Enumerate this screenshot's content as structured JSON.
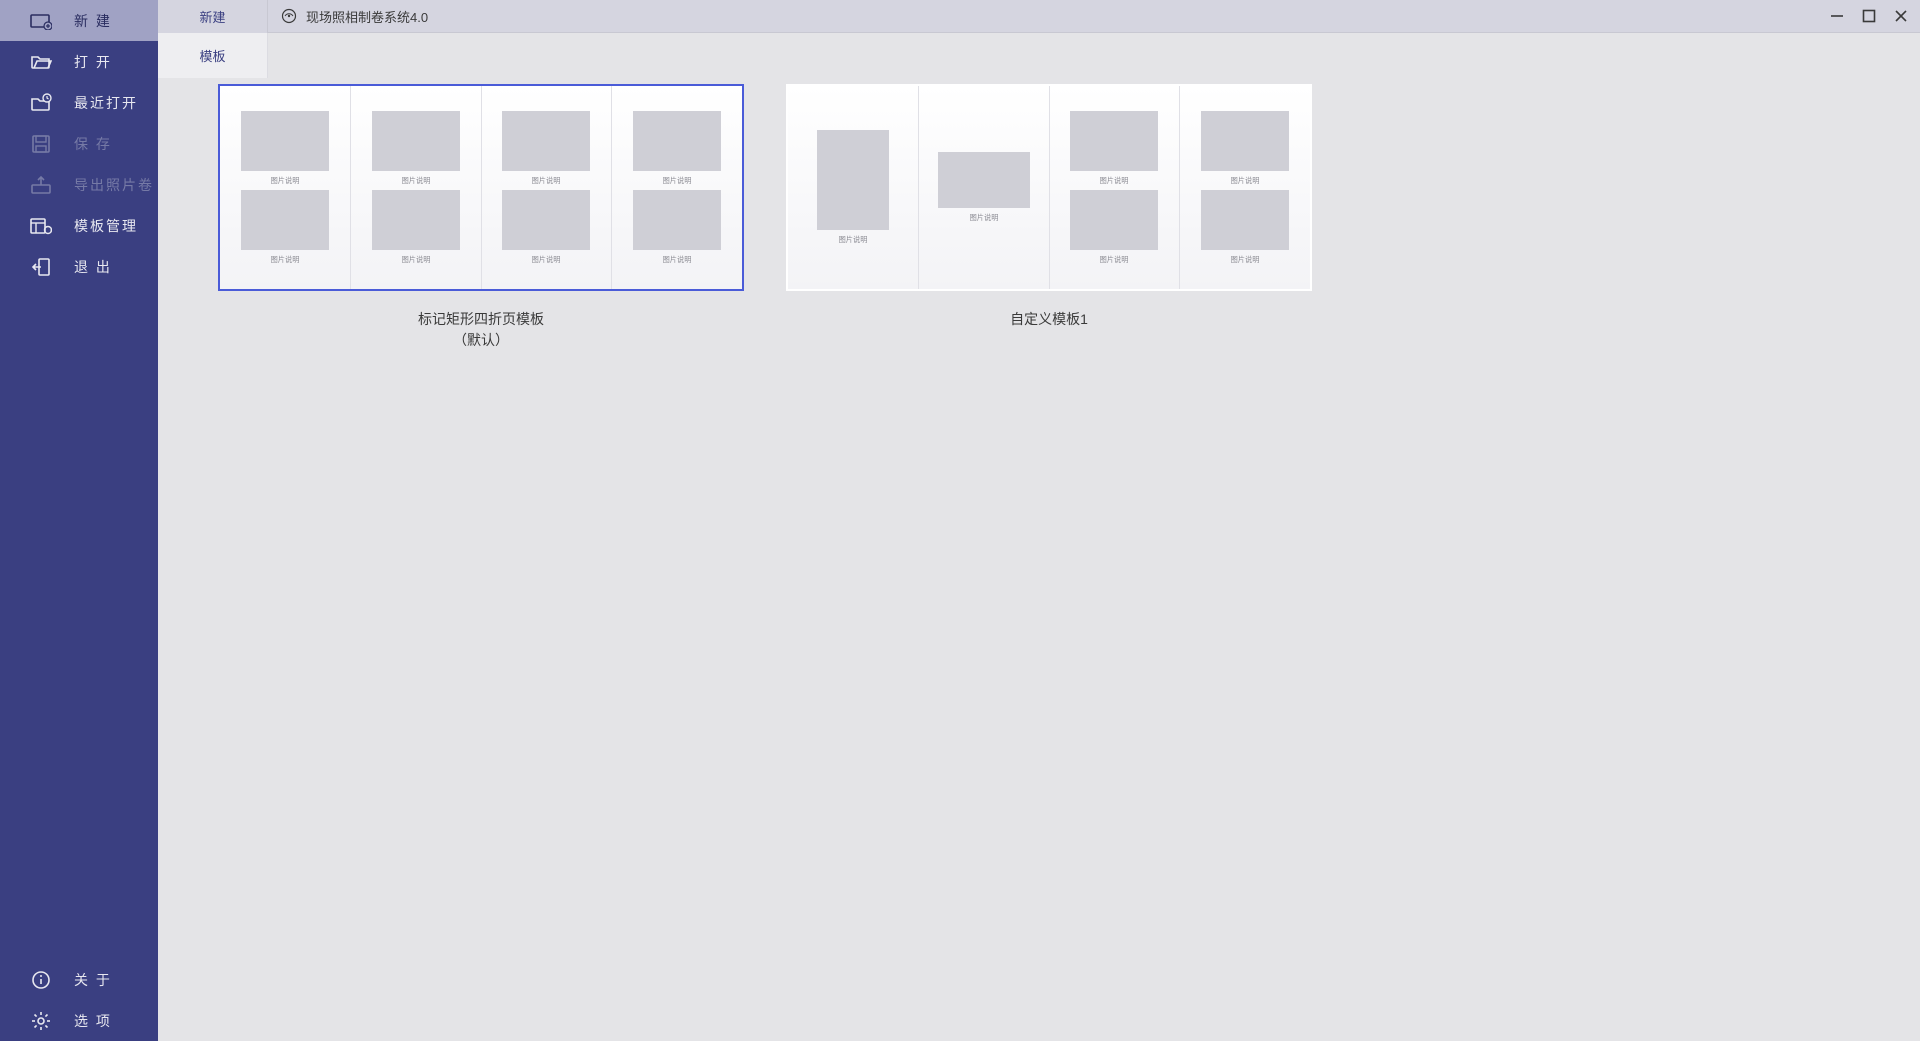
{
  "app": {
    "title": "现场照相制卷系统4.0"
  },
  "titlebar": {
    "tab_label": "新建"
  },
  "sidebar": {
    "new": "新 建",
    "open": "打 开",
    "recent": "最近打开",
    "save": "保 存",
    "export": "导出照片卷",
    "template_mgmt": "模板管理",
    "exit": "退 出",
    "about": "关 于",
    "options": "选 项"
  },
  "subtab": {
    "templates": "模板"
  },
  "placeholder": {
    "caption": "图片说明"
  },
  "templates": [
    {
      "name": "标记矩形四折页模板",
      "subtitle": "（默认）",
      "selected": true,
      "layout": "four-fold-2rows"
    },
    {
      "name": "自定义模板1",
      "subtitle": "",
      "selected": false,
      "layout": "custom1"
    }
  ]
}
